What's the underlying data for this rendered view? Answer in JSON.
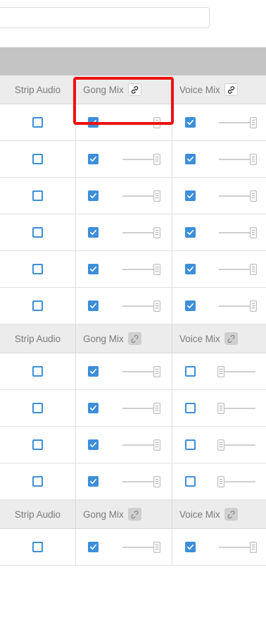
{
  "search": {
    "placeholder": ""
  },
  "colors": {
    "accent": "#3d8fd9",
    "highlight": "#ee1111",
    "header_bg": "#ececec",
    "band": "#c4c4c4"
  },
  "icons": {
    "check": "check-icon",
    "link": "link-icon",
    "unlink": "unlink-icon",
    "slider_thumb": "slider-thumb-icon"
  },
  "sections": [
    {
      "header": {
        "strip": "Strip Audio",
        "gong": "Gong Mix",
        "voice": "Voice Mix",
        "gong_link": "linked",
        "voice_link": "linked"
      },
      "rows": [
        {
          "strip": false,
          "gong": true,
          "gong_level": 1.0,
          "voice": true,
          "voice_level": 1.0
        },
        {
          "strip": false,
          "gong": true,
          "gong_level": 1.0,
          "voice": true,
          "voice_level": 1.0
        },
        {
          "strip": false,
          "gong": true,
          "gong_level": 1.0,
          "voice": true,
          "voice_level": 1.0
        },
        {
          "strip": false,
          "gong": true,
          "gong_level": 1.0,
          "voice": true,
          "voice_level": 1.0
        },
        {
          "strip": false,
          "gong": true,
          "gong_level": 1.0,
          "voice": true,
          "voice_level": 1.0
        },
        {
          "strip": false,
          "gong": true,
          "gong_level": 1.0,
          "voice": true,
          "voice_level": 1.0
        }
      ]
    },
    {
      "header": {
        "strip": "Strip Audio",
        "gong": "Gong Mix",
        "voice": "Voice Mix",
        "gong_link": "unlinked",
        "voice_link": "unlinked"
      },
      "rows": [
        {
          "strip": false,
          "gong": true,
          "gong_level": 1.0,
          "voice": false,
          "voice_level": 0.0
        },
        {
          "strip": false,
          "gong": true,
          "gong_level": 1.0,
          "voice": false,
          "voice_level": 0.0
        },
        {
          "strip": false,
          "gong": true,
          "gong_level": 1.0,
          "voice": false,
          "voice_level": 0.0
        },
        {
          "strip": false,
          "gong": true,
          "gong_level": 1.0,
          "voice": false,
          "voice_level": 0.0
        }
      ]
    },
    {
      "header": {
        "strip": "Strip Audio",
        "gong": "Gong Mix",
        "voice": "Voice Mix",
        "gong_link": "unlinked",
        "voice_link": "unlinked"
      },
      "rows": [
        {
          "strip": false,
          "gong": true,
          "gong_level": 1.0,
          "voice": true,
          "voice_level": 1.0
        }
      ]
    }
  ]
}
